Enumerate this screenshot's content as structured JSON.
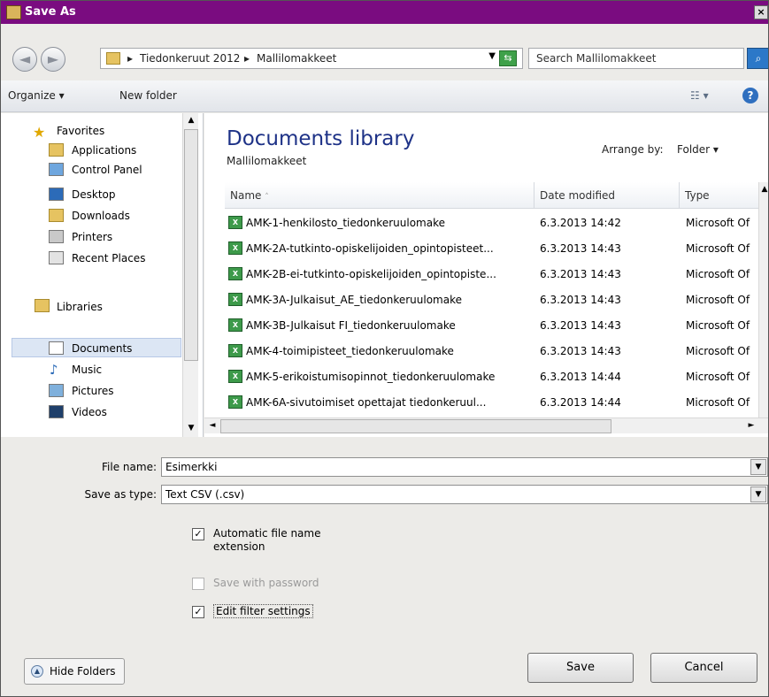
{
  "window": {
    "title": "Save As"
  },
  "address": {
    "crumbs": [
      "Tiedonkeruut 2012",
      "Mallilomakkeet"
    ],
    "search_placeholder": "Search Mallilomakkeet"
  },
  "toolbar": {
    "organize_label": "Organize ▾",
    "new_folder_label": "New folder"
  },
  "nav": {
    "favorites_label": "Favorites",
    "favorites": [
      "Applications",
      "Control Panel",
      "Desktop",
      "Downloads",
      "Printers",
      "Recent Places"
    ],
    "libraries_label": "Libraries",
    "libraries": [
      "Documents",
      "Music",
      "Pictures",
      "Videos"
    ],
    "selected": "Documents"
  },
  "library": {
    "title": "Documents library",
    "subtitle": "Mallilomakkeet",
    "arrange_label": "Arrange by:",
    "arrange_value": "Folder ▾"
  },
  "columns": {
    "name": "Name",
    "date": "Date modified",
    "type": "Type"
  },
  "files": [
    {
      "name": "AMK-1-henkilosto_tiedonkeruulomake",
      "date": "6.3.2013 14:42",
      "type": "Microsoft Of"
    },
    {
      "name": "AMK-2A-tutkinto-opiskelijoiden_opintopisteet...",
      "date": "6.3.2013 14:43",
      "type": "Microsoft Of"
    },
    {
      "name": "AMK-2B-ei-tutkinto-opiskelijoiden_opintopiste...",
      "date": "6.3.2013 14:43",
      "type": "Microsoft Of"
    },
    {
      "name": "AMK-3A-Julkaisut_AE_tiedonkeruulomake",
      "date": "6.3.2013 14:43",
      "type": "Microsoft Of"
    },
    {
      "name": "AMK-3B-Julkaisut FI_tiedonkeruulomake",
      "date": "6.3.2013 14:43",
      "type": "Microsoft Of"
    },
    {
      "name": "AMK-4-toimipisteet_tiedonkeruulomake",
      "date": "6.3.2013 14:43",
      "type": "Microsoft Of"
    },
    {
      "name": "AMK-5-erikoistumisopinnot_tiedonkeruulomake",
      "date": "6.3.2013 14:44",
      "type": "Microsoft Of"
    },
    {
      "name": "AMK-6A-sivutoimiset opettajat tiedonkeruul...",
      "date": "6.3.2013 14:44",
      "type": "Microsoft Of"
    }
  ],
  "form": {
    "file_name_label": "File name:",
    "file_name_value": "Esimerkki",
    "save_type_label": "Save as type:",
    "save_type_value": "Text CSV (.csv)"
  },
  "options": {
    "auto_ext_label_1": "Automatic file name",
    "auto_ext_label_2": "extension",
    "auto_ext_checked": true,
    "password_label": "Save with password",
    "password_checked": false,
    "password_enabled": false,
    "filter_label": "Edit filter settings",
    "filter_checked": true
  },
  "buttons": {
    "hide_folders": "Hide Folders",
    "save": "Save",
    "cancel": "Cancel"
  }
}
